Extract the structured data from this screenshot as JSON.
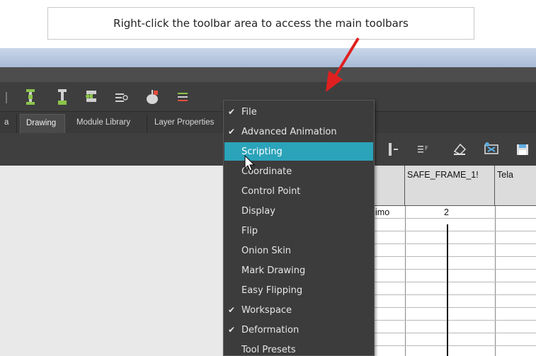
{
  "callout": {
    "text": "Right-click the toolbar area to access the main toolbars"
  },
  "colors": {
    "arrow": "#e02020",
    "menu_bg": "#3c3c3c",
    "menu_highlight": "#2ba3b9",
    "toolbar_bg": "#3e3e3e",
    "title_bar": "#b6c6de"
  },
  "tabs": [
    {
      "label": "a"
    },
    {
      "label": "Drawing"
    },
    {
      "label": "Module Library"
    },
    {
      "label": "Layer Properties"
    }
  ],
  "toolbar_icons": [
    "add-drawing-icon",
    "insert-drawing-icon",
    "swap-drawing-icon",
    "search-layer-icon",
    "onion-skin-icon",
    "drawing-list-icon"
  ],
  "view_toolbar_icons": [
    "bracket-icon",
    "layer-list-icon",
    "paint-bucket-icon",
    "eraser-icon",
    "save-icon"
  ],
  "xsheet": {
    "columns": [
      {
        "label": ""
      },
      {
        "label": "SAFE_FRAME_1!"
      },
      {
        "label": "Tela"
      }
    ],
    "rows": [
      {
        "cells": [
          "imo",
          "2",
          ""
        ]
      }
    ]
  },
  "context_menu": {
    "items": [
      {
        "label": "File",
        "checked": "✔"
      },
      {
        "label": "Advanced Animation",
        "checked": "✔"
      },
      {
        "label": "Scripting",
        "checked": ""
      },
      {
        "label": "Coordinate",
        "checked": ""
      },
      {
        "label": "Control Point",
        "checked": ""
      },
      {
        "label": "Display",
        "checked": ""
      },
      {
        "label": "Flip",
        "checked": ""
      },
      {
        "label": "Onion Skin",
        "checked": ""
      },
      {
        "label": "Mark Drawing",
        "checked": ""
      },
      {
        "label": "Easy Flipping",
        "checked": ""
      },
      {
        "label": "Workspace",
        "checked": "✔"
      },
      {
        "label": "Deformation",
        "checked": "✔"
      },
      {
        "label": "Tool Presets",
        "checked": ""
      }
    ],
    "highlighted": "Scripting"
  }
}
